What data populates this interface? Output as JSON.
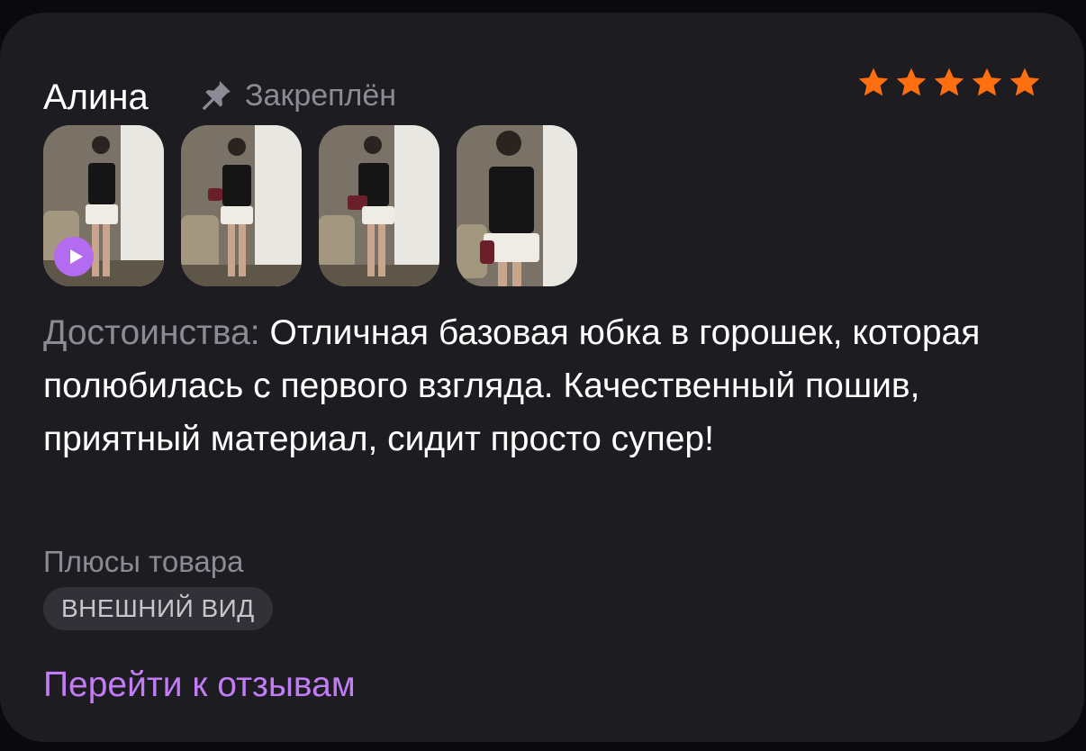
{
  "review": {
    "author": "Алина",
    "pinned_label": "Закреплён",
    "rating": 5,
    "rating_max": 5,
    "star_color": "#ff6f0f",
    "photos": [
      {
        "kind": "video-thumbnail",
        "has_play": true
      },
      {
        "kind": "photo-thumbnail",
        "has_play": false
      },
      {
        "kind": "photo-thumbnail",
        "has_play": false
      },
      {
        "kind": "photo-thumbnail",
        "has_play": false
      }
    ],
    "advantages_label": "Достоинства:",
    "advantages_text": "Отличная базовая юбка в горошек, которая полюбилась с первого взгляда. Качественный пошив, приятный материал, сидит просто супер!",
    "pros_label": "Плюсы товара",
    "tags": [
      "ВНЕШНИЙ ВИД"
    ],
    "link_label": "Перейти к отзывам",
    "accent_color": "#c27cf6"
  }
}
